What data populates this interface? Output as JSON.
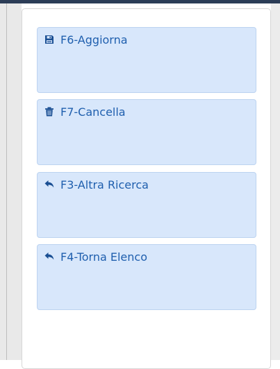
{
  "actions": [
    {
      "label": "F6-Aggiorna",
      "icon": "save-icon"
    },
    {
      "label": "F7-Cancella",
      "icon": "trash-icon"
    },
    {
      "label": "F3-Altra Ricerca",
      "icon": "reply-icon"
    },
    {
      "label": "F4-Torna Elenco",
      "icon": "reply-icon"
    }
  ],
  "colors": {
    "button_bg": "#d8e7fb",
    "button_text": "#1f5fae",
    "icon": "#1a4f93",
    "header": "#2c3d57"
  }
}
